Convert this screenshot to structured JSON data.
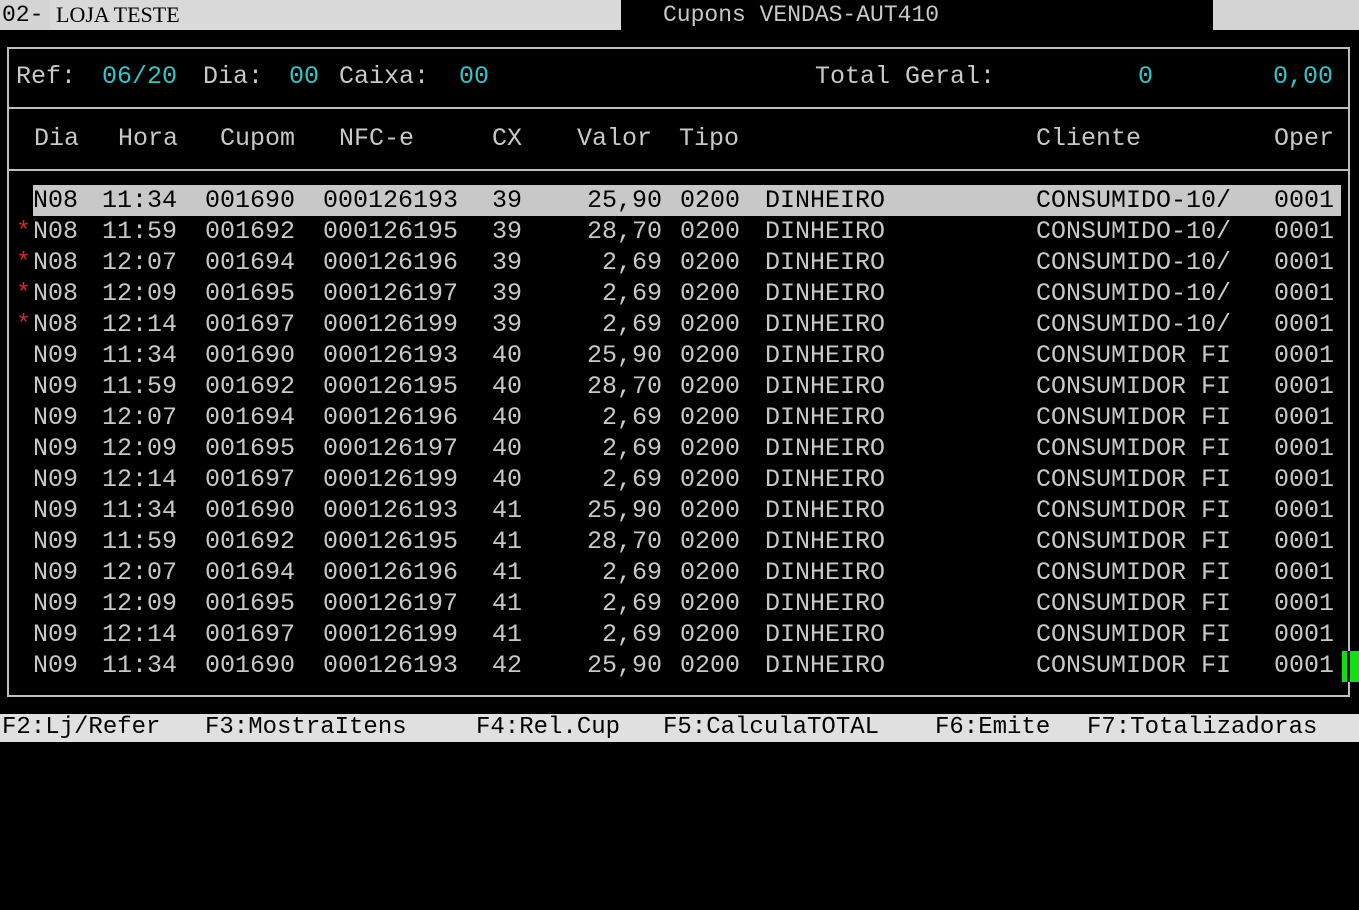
{
  "titlebar": {
    "number": "02-",
    "store": "LOJA TESTE",
    "title": "Cupons VENDAS-AUT410"
  },
  "info": {
    "ref_label": "Ref:",
    "ref_value": "06/20",
    "dia_label": "Dia:",
    "dia_value": "00",
    "caixa_label": "Caixa:",
    "caixa_value": "00",
    "total_label": "Total Geral:",
    "total_count": "0",
    "total_value": "0,00"
  },
  "table": {
    "headers": {
      "dia": "Dia",
      "hora": "Hora",
      "cupom": "Cupom",
      "nfce": "NFC-e",
      "cx": "CX",
      "valor": "Valor",
      "tipo": "Tipo",
      "cliente": "Cliente",
      "oper": "Oper"
    },
    "rows": [
      {
        "mark": "*",
        "dia": "N08",
        "hora": "11:34",
        "cupom": "001690",
        "nfce": "000126193",
        "cx": "39",
        "valor": "25,90",
        "tipo": "0200",
        "pag": "DINHEIRO",
        "cliente": "CONSUMIDO-10/",
        "oper": "0001"
      },
      {
        "mark": "*",
        "dia": "N08",
        "hora": "11:59",
        "cupom": "001692",
        "nfce": "000126195",
        "cx": "39",
        "valor": "28,70",
        "tipo": "0200",
        "pag": "DINHEIRO",
        "cliente": "CONSUMIDO-10/",
        "oper": "0001"
      },
      {
        "mark": "*",
        "dia": "N08",
        "hora": "12:07",
        "cupom": "001694",
        "nfce": "000126196",
        "cx": "39",
        "valor": "2,69",
        "tipo": "0200",
        "pag": "DINHEIRO",
        "cliente": "CONSUMIDO-10/",
        "oper": "0001"
      },
      {
        "mark": "*",
        "dia": "N08",
        "hora": "12:09",
        "cupom": "001695",
        "nfce": "000126197",
        "cx": "39",
        "valor": "2,69",
        "tipo": "0200",
        "pag": "DINHEIRO",
        "cliente": "CONSUMIDO-10/",
        "oper": "0001"
      },
      {
        "mark": "*",
        "dia": "N08",
        "hora": "12:14",
        "cupom": "001697",
        "nfce": "000126199",
        "cx": "39",
        "valor": "2,69",
        "tipo": "0200",
        "pag": "DINHEIRO",
        "cliente": "CONSUMIDO-10/",
        "oper": "0001"
      },
      {
        "mark": "",
        "dia": "N09",
        "hora": "11:34",
        "cupom": "001690",
        "nfce": "000126193",
        "cx": "40",
        "valor": "25,90",
        "tipo": "0200",
        "pag": "DINHEIRO",
        "cliente": "CONSUMIDOR FI",
        "oper": "0001"
      },
      {
        "mark": "",
        "dia": "N09",
        "hora": "11:59",
        "cupom": "001692",
        "nfce": "000126195",
        "cx": "40",
        "valor": "28,70",
        "tipo": "0200",
        "pag": "DINHEIRO",
        "cliente": "CONSUMIDOR FI",
        "oper": "0001"
      },
      {
        "mark": "",
        "dia": "N09",
        "hora": "12:07",
        "cupom": "001694",
        "nfce": "000126196",
        "cx": "40",
        "valor": "2,69",
        "tipo": "0200",
        "pag": "DINHEIRO",
        "cliente": "CONSUMIDOR FI",
        "oper": "0001"
      },
      {
        "mark": "",
        "dia": "N09",
        "hora": "12:09",
        "cupom": "001695",
        "nfce": "000126197",
        "cx": "40",
        "valor": "2,69",
        "tipo": "0200",
        "pag": "DINHEIRO",
        "cliente": "CONSUMIDOR FI",
        "oper": "0001"
      },
      {
        "mark": "",
        "dia": "N09",
        "hora": "12:14",
        "cupom": "001697",
        "nfce": "000126199",
        "cx": "40",
        "valor": "2,69",
        "tipo": "0200",
        "pag": "DINHEIRO",
        "cliente": "CONSUMIDOR FI",
        "oper": "0001"
      },
      {
        "mark": "",
        "dia": "N09",
        "hora": "11:34",
        "cupom": "001690",
        "nfce": "000126193",
        "cx": "41",
        "valor": "25,90",
        "tipo": "0200",
        "pag": "DINHEIRO",
        "cliente": "CONSUMIDOR FI",
        "oper": "0001"
      },
      {
        "mark": "",
        "dia": "N09",
        "hora": "11:59",
        "cupom": "001692",
        "nfce": "000126195",
        "cx": "41",
        "valor": "28,70",
        "tipo": "0200",
        "pag": "DINHEIRO",
        "cliente": "CONSUMIDOR FI",
        "oper": "0001"
      },
      {
        "mark": "",
        "dia": "N09",
        "hora": "12:07",
        "cupom": "001694",
        "nfce": "000126196",
        "cx": "41",
        "valor": "2,69",
        "tipo": "0200",
        "pag": "DINHEIRO",
        "cliente": "CONSUMIDOR FI",
        "oper": "0001"
      },
      {
        "mark": "",
        "dia": "N09",
        "hora": "12:09",
        "cupom": "001695",
        "nfce": "000126197",
        "cx": "41",
        "valor": "2,69",
        "tipo": "0200",
        "pag": "DINHEIRO",
        "cliente": "CONSUMIDOR FI",
        "oper": "0001"
      },
      {
        "mark": "",
        "dia": "N09",
        "hora": "12:14",
        "cupom": "001697",
        "nfce": "000126199",
        "cx": "41",
        "valor": "2,69",
        "tipo": "0200",
        "pag": "DINHEIRO",
        "cliente": "CONSUMIDOR FI",
        "oper": "0001"
      },
      {
        "mark": "",
        "dia": "N09",
        "hora": "11:34",
        "cupom": "001690",
        "nfce": "000126193",
        "cx": "42",
        "valor": "25,90",
        "tipo": "0200",
        "pag": "DINHEIRO",
        "cliente": "CONSUMIDOR FI",
        "oper": "0001"
      }
    ],
    "selected_row": 0
  },
  "function_keys": [
    "F2:Lj/Refer",
    "F3:MostraItens",
    "F4:Rel.Cup",
    "F5:CalculaTOTAL",
    "F6:Emite",
    "F7:Totalizadoras"
  ],
  "colors": {
    "background": "#000000",
    "text": "#c8c8c8",
    "value_cyan": "#2fc7c7",
    "mark_red": "#d42a2a",
    "cursor_green": "#12e012"
  }
}
